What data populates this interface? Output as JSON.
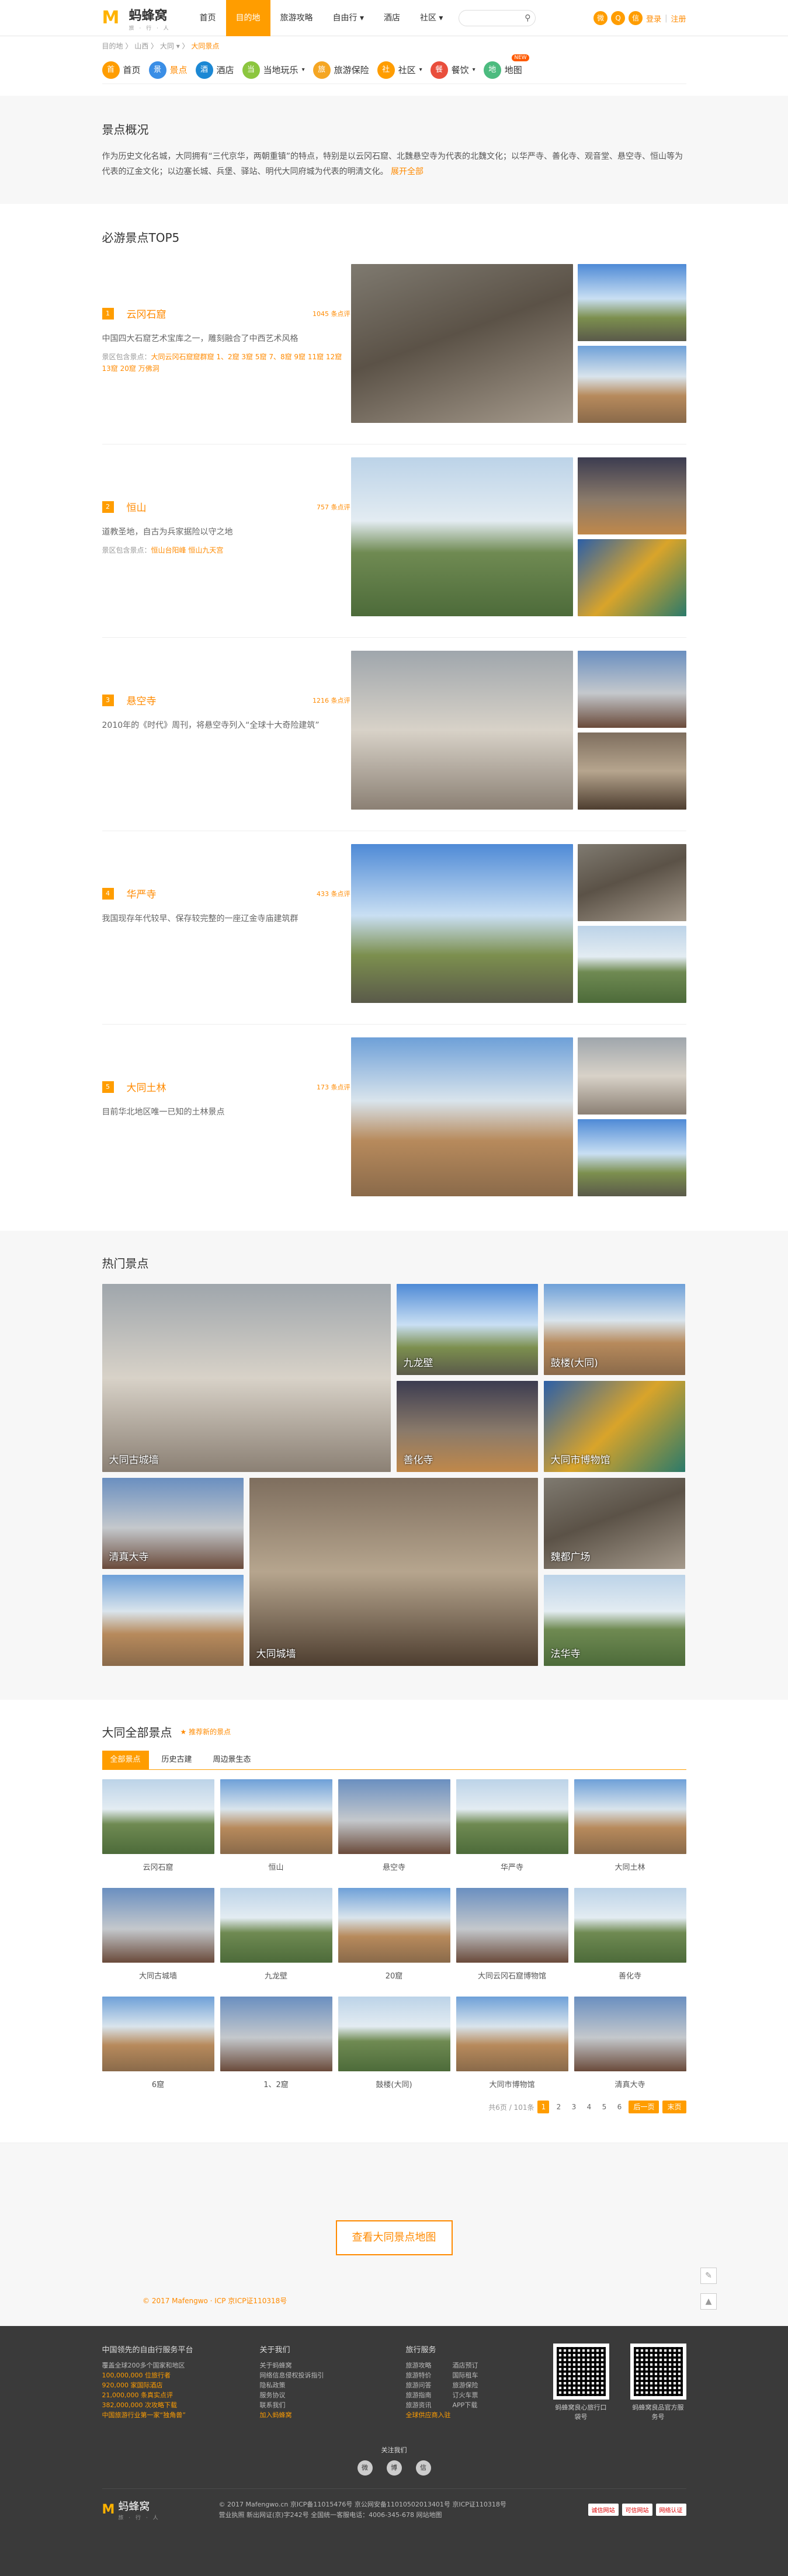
{
  "header": {
    "brand": "蚂蜂窝",
    "tagline": "旅 · 行 · 人",
    "nav": [
      "首页",
      "目的地",
      "旅游攻略",
      "自由行 ▾",
      "酒店",
      "社区 ▾"
    ],
    "search_placeholder": "",
    "login": "登录",
    "register": "注册"
  },
  "crumb": {
    "items": [
      "目的地",
      "〉",
      "山西",
      "〉",
      "大同 ▾",
      "〉"
    ],
    "current": "大同景点"
  },
  "subnav": [
    {
      "label": "首页",
      "icon": "home-icon",
      "color": "#ff9d00"
    },
    {
      "label": "景点",
      "icon": "camera-icon",
      "color": "#3a8ee6"
    },
    {
      "label": "酒店",
      "icon": "bed-icon",
      "color": "#1c88d4"
    },
    {
      "label": "当地玩乐",
      "icon": "play-icon",
      "color": "#8cc63f"
    },
    {
      "label": "旅游保险",
      "icon": "shield-icon",
      "color": "#f5a623"
    },
    {
      "label": "社区",
      "icon": "people-icon",
      "color": "#ff9d00"
    },
    {
      "label": "餐饮",
      "icon": "food-icon",
      "color": "#e94e3c"
    },
    {
      "label": "地图",
      "icon": "map-icon",
      "color": "#4cbb7f",
      "badge": "NEW"
    }
  ],
  "overview": {
    "title": "景点概况",
    "text": "作为历史文化名城，大同拥有“三代京华，两朝重镇”的特点，特别是以云冈石窟、北魏悬空寺为代表的北魏文化；以华严寺、善化寺、观音堂、悬空寺、恒山等为代表的辽金文化；以边塞长城、兵堡、驿站、明代大同府城为代表的明清文化。",
    "more": "展开全部"
  },
  "top5": {
    "title": "必游景点TOP5",
    "items": [
      {
        "rank": "1",
        "name": "云冈石窟",
        "count": "1045 条点评",
        "desc": "中国四大石窟艺术宝库之一，雕刻融合了中西艺术风格",
        "tags_label": "景区包含景点：",
        "tags": "大同云冈石窟窟群窟 1、2窟 3窟 5窟 7、8窟 9窟 11窟 12窟 13窟 20窟 万佛洞"
      },
      {
        "rank": "2",
        "name": "恒山",
        "count": "757 条点评",
        "desc": "道教圣地，自古为兵家据险以守之地",
        "tags_label": "景区包含景点：",
        "tags": "恒山台阳峰 恒山九天宫"
      },
      {
        "rank": "3",
        "name": "悬空寺",
        "count": "1216 条点评",
        "desc": "2010年的《时代》周刊，将悬空寺列入“全球十大奇险建筑”",
        "tags_label": "",
        "tags": ""
      },
      {
        "rank": "4",
        "name": "华严寺",
        "count": "433 条点评",
        "desc": "我国现存年代较早、保存较完整的一座辽金寺庙建筑群",
        "tags_label": "",
        "tags": ""
      },
      {
        "rank": "5",
        "name": "大同土林",
        "count": "173 条点评",
        "desc": "目前华北地区唯一已知的土林景点",
        "tags_label": "",
        "tags": ""
      }
    ]
  },
  "hot": {
    "title": "热门景点",
    "items": [
      "大同古城墙",
      "九龙壁",
      "鼓楼(大同)",
      "善化寺",
      "大同市博物馆",
      "清真大寺",
      "大同城墙",
      "魏都广场",
      "法华寺"
    ]
  },
  "all": {
    "title": "大同全部景点",
    "link": "★ 推荐新的景点",
    "tabs": [
      "全部景点",
      "历史古建",
      "周边景生态"
    ],
    "items": [
      "云冈石窟",
      "恒山",
      "悬空寺",
      "华严寺",
      "大同土林",
      "大同古城墙",
      "九龙壁",
      "20窟",
      "大同云冈石窟博物馆",
      "善化寺",
      "6窟",
      "1、2窟",
      "鼓楼(大同)",
      "大同市博物馆",
      "清真大寺"
    ],
    "pager": {
      "total": "共6页 / 101条",
      "pages": [
        "1",
        "2",
        "3",
        "4",
        "5",
        "6"
      ],
      "next": "后一页",
      "last": "末页"
    }
  },
  "map": {
    "button": "查看大同景点地图"
  },
  "copyright": "© 2017 Mafengwo · ICP 京ICP证110318号",
  "footer": {
    "col1": {
      "title": "中国领先的自由行服务平台",
      "lines": [
        "覆盖全球200多个国家和地区",
        "100,000,000 位旅行者",
        "920,000 家国际酒店",
        "21,000,000 条真实点评",
        "382,000,000 次攻略下载",
        "中国旅游行业第一家“独角兽”"
      ]
    },
    "col2": {
      "title": "关于我们",
      "lines": [
        "关于蚂蜂窝",
        "网络信息侵权投诉指引",
        "隐私政策",
        "服务协议",
        "联系我们",
        "加入蚂蜂窝"
      ]
    },
    "col3": {
      "title": "旅行服务",
      "lines": [
        "旅游攻略",
        "酒店预订",
        "旅游特价",
        "国际租车",
        "旅游问答",
        "旅游保险",
        "旅游指南",
        "订火车票",
        "旅游资讯",
        "APP下载",
        "全球供应商入驻"
      ]
    },
    "qr1": "蚂蜂窝良心旅行口袋号",
    "qr2": "蚂蜂窝良品官方服务号",
    "follow": "关注我们",
    "social": [
      "微",
      "博",
      "信"
    ],
    "bottom1": "© 2017 Mafengwo.cn 京ICP备11015476号 京公网安备11010502013401号 京ICP证110318号",
    "bottom2": "营业执照 新出网证(京)字242号 全国统一客服电话：4006-345-678 网站地图",
    "badges": [
      "诚信网站",
      "可信网站",
      "网络认证"
    ]
  }
}
